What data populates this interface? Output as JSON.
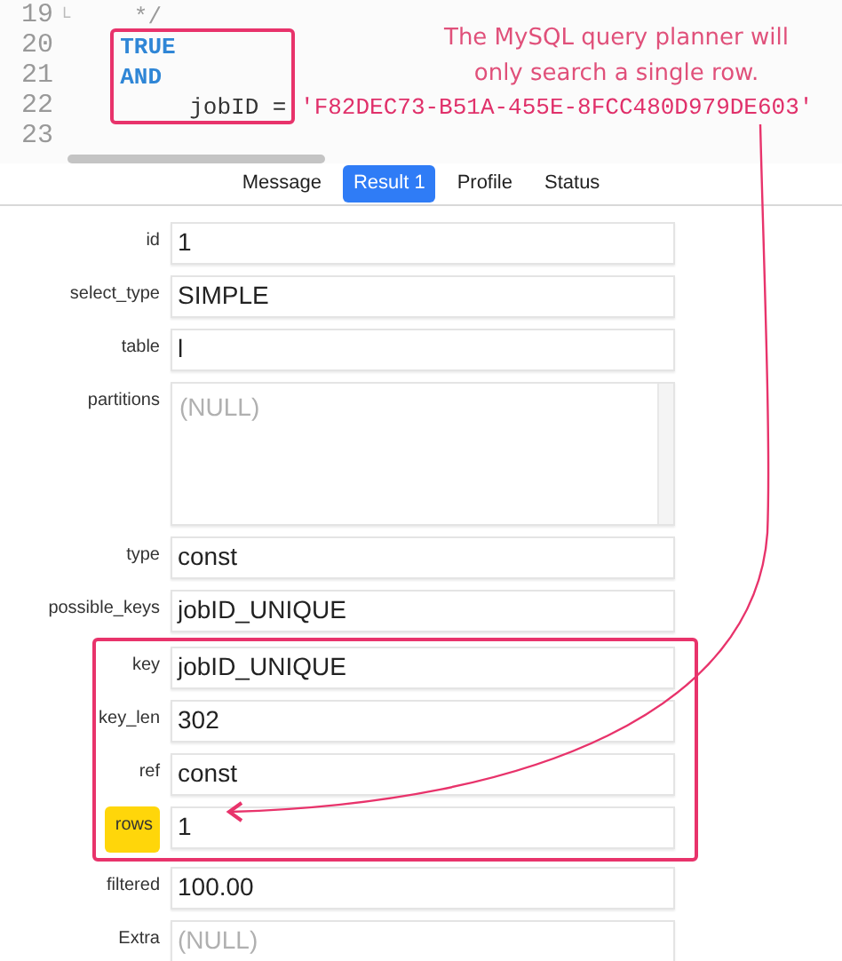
{
  "code_lines": [
    {
      "number": "19",
      "fold": "└",
      "tokens": [
        {
          "text": "   */",
          "kind": "comment"
        }
      ]
    },
    {
      "number": "20",
      "tokens": [
        {
          "text": "  TRUE",
          "kind": "keyword"
        }
      ]
    },
    {
      "number": "21",
      "tokens": [
        {
          "text": "  AND",
          "kind": "keyword"
        }
      ]
    },
    {
      "number": "22",
      "tokens": [
        {
          "text": "       jobID = ",
          "kind": "plain"
        },
        {
          "text": "'F82DEC73-B51A-455E-8FCC480D979DE603'",
          "kind": "string"
        }
      ]
    },
    {
      "number": "23"
    }
  ],
  "annotation": {
    "lines": [
      "The MySQL query planner will",
      "only search a single row."
    ]
  },
  "tabs": [
    {
      "label": "Message",
      "selected": false
    },
    {
      "label": "Result 1",
      "selected": true
    },
    {
      "label": "Profile",
      "selected": false
    },
    {
      "label": "Status",
      "selected": false
    }
  ],
  "fields": [
    {
      "label": "id",
      "value": "1",
      "kind": "text",
      "highlighted": false
    },
    {
      "label": "select_type",
      "value": "SIMPLE",
      "kind": "text",
      "highlighted": false
    },
    {
      "label": "table",
      "value": "l",
      "kind": "text",
      "highlighted": false
    },
    {
      "label": "partitions",
      "value": "(NULL)",
      "kind": "null-area",
      "highlighted": false
    },
    {
      "label": "type",
      "value": "const",
      "kind": "text",
      "highlighted": false
    },
    {
      "label": "possible_keys",
      "value": "jobID_UNIQUE",
      "kind": "text",
      "highlighted": false
    },
    {
      "label": "key",
      "value": "jobID_UNIQUE",
      "kind": "text",
      "highlighted": false,
      "boxed": true
    },
    {
      "label": "key_len",
      "value": "302",
      "kind": "text",
      "highlighted": false,
      "boxed": true
    },
    {
      "label": "ref",
      "value": "const",
      "kind": "text",
      "highlighted": false,
      "boxed": true
    },
    {
      "label": "rows",
      "value": "1",
      "kind": "text",
      "highlighted": true,
      "boxed": true
    },
    {
      "label": "filtered",
      "value": "100.00",
      "kind": "text",
      "highlighted": false
    },
    {
      "label": "Extra",
      "value": "(NULL)",
      "kind": "null",
      "highlighted": false
    }
  ]
}
